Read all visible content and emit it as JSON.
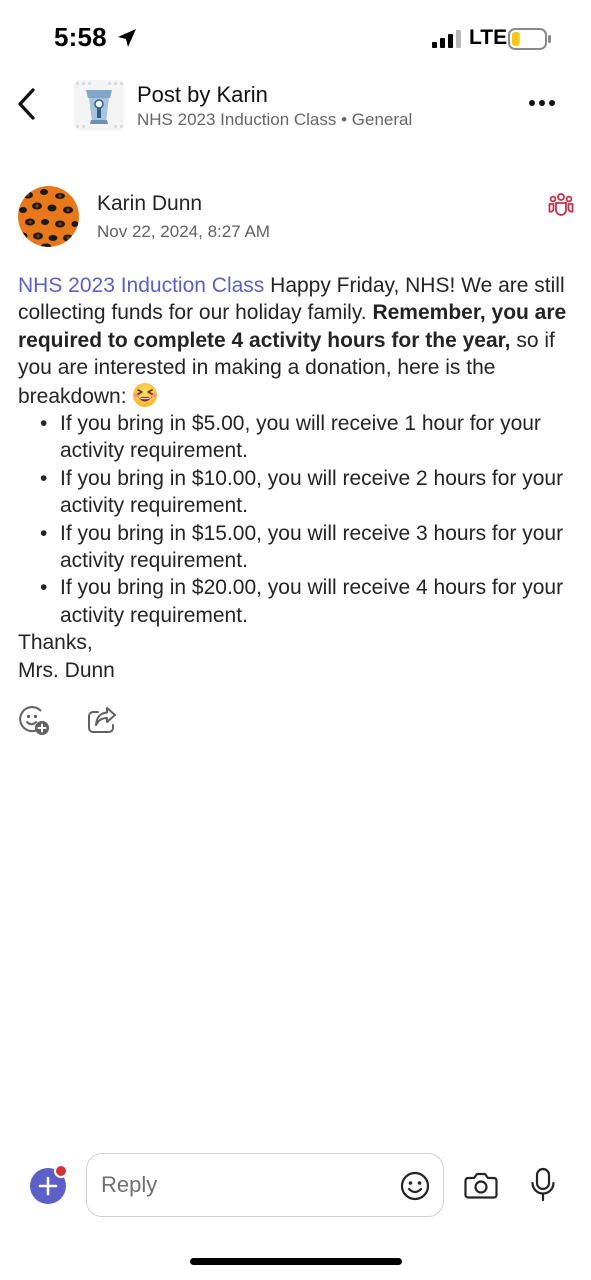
{
  "status_bar": {
    "time": "5:58",
    "carrier": "LTE"
  },
  "header": {
    "title": "Post by Karin",
    "subtitle": "NHS 2023 Induction Class • General"
  },
  "post": {
    "author": "Karin Dunn",
    "timestamp": "Nov 22, 2024, 8:27 AM",
    "mention": "NHS 2023 Induction Class",
    "intro": " Happy Friday, NHS! We are still collecting funds for our holiday family. ",
    "bold": "Remember, you are required to complete 4 activity hours for the year,",
    "after_bold": " so if you are interested in making a donation, here is the breakdown: ",
    "bullets": [
      "If you bring in $5.00, you will receive 1 hour for your activity requirement.",
      "If you bring in $10.00, you will receive 2 hours for your activity requirement.",
      "If you bring in $15.00, you will receive 3 hours for your activity requirement.",
      "If you bring in $20.00, you will receive 4 hours for your activity requirement."
    ],
    "closing": "Thanks,",
    "signature": "Mrs. Dunn"
  },
  "composer": {
    "placeholder": "Reply"
  },
  "icons": {
    "back": "chevron-left-icon",
    "more": "more-horizontal-icon",
    "team": "team-icon",
    "react": "add-reaction-icon",
    "share": "share-icon",
    "plus": "plus-icon",
    "emoji": "emoji-icon",
    "camera": "camera-icon",
    "mic": "microphone-icon"
  },
  "colors": {
    "accent": "#5b5fc7",
    "notification": "#d13438",
    "battery_fill": "#f5c518"
  },
  "battery_level": 0.25
}
